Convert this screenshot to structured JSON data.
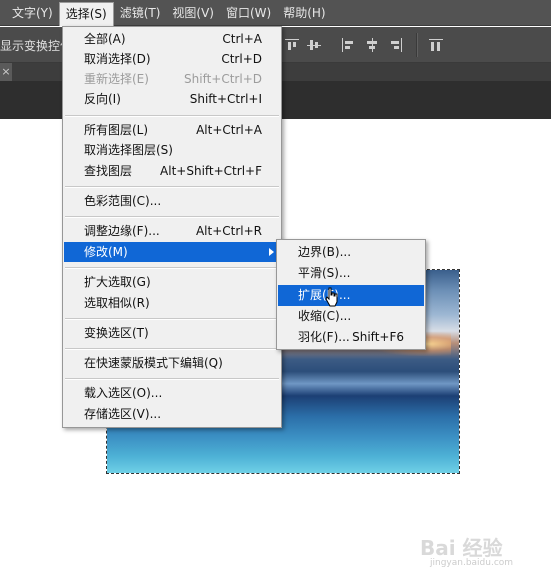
{
  "menubar": {
    "items": [
      {
        "label": "文字(Y)"
      },
      {
        "label": "选择(S)"
      },
      {
        "label": "滤镜(T)"
      },
      {
        "label": "视图(V)"
      },
      {
        "label": "窗口(W)"
      },
      {
        "label": "帮助(H)"
      }
    ],
    "active_index": 1
  },
  "options_bar": {
    "transform_controls_label": "显示变换控件"
  },
  "select_menu": {
    "items": [
      {
        "label": "全部(A)",
        "shortcut": "Ctrl+A"
      },
      {
        "label": "取消选择(D)",
        "shortcut": "Ctrl+D"
      },
      {
        "label": "重新选择(E)",
        "shortcut": "Shift+Ctrl+D",
        "disabled": true
      },
      {
        "label": "反向(I)",
        "shortcut": "Shift+Ctrl+I"
      },
      {
        "label": "所有图层(L)",
        "shortcut": "Alt+Ctrl+A"
      },
      {
        "label": "取消选择图层(S)",
        "shortcut": ""
      },
      {
        "label": "查找图层",
        "shortcut": "Alt+Shift+Ctrl+F"
      },
      {
        "label": "色彩范围(C)...",
        "shortcut": ""
      },
      {
        "label": "调整边缘(F)...",
        "shortcut": "Alt+Ctrl+R"
      },
      {
        "label": "修改(M)",
        "shortcut": "",
        "submenu": true,
        "highlighted": true
      },
      {
        "label": "扩大选取(G)",
        "shortcut": ""
      },
      {
        "label": "选取相似(R)",
        "shortcut": ""
      },
      {
        "label": "变换选区(T)",
        "shortcut": ""
      },
      {
        "label": "在快速蒙版模式下编辑(Q)",
        "shortcut": ""
      },
      {
        "label": "载入选区(O)...",
        "shortcut": ""
      },
      {
        "label": "存储选区(V)...",
        "shortcut": ""
      }
    ]
  },
  "modify_submenu": {
    "items": [
      {
        "label": "边界(B)...",
        "shortcut": ""
      },
      {
        "label": "平滑(S)...",
        "shortcut": ""
      },
      {
        "label": "扩展(E)...",
        "shortcut": "",
        "highlighted": true
      },
      {
        "label": "收缩(C)...",
        "shortcut": ""
      },
      {
        "label": "羽化(F)...",
        "shortcut": "Shift+F6"
      }
    ]
  },
  "watermark": {
    "text": "Bai 经验",
    "sub": "jingyan.baidu.com"
  },
  "colors": {
    "menubar_bg": "#535353",
    "menu_bg": "#f0f0f0",
    "highlight": "#1067d6"
  }
}
